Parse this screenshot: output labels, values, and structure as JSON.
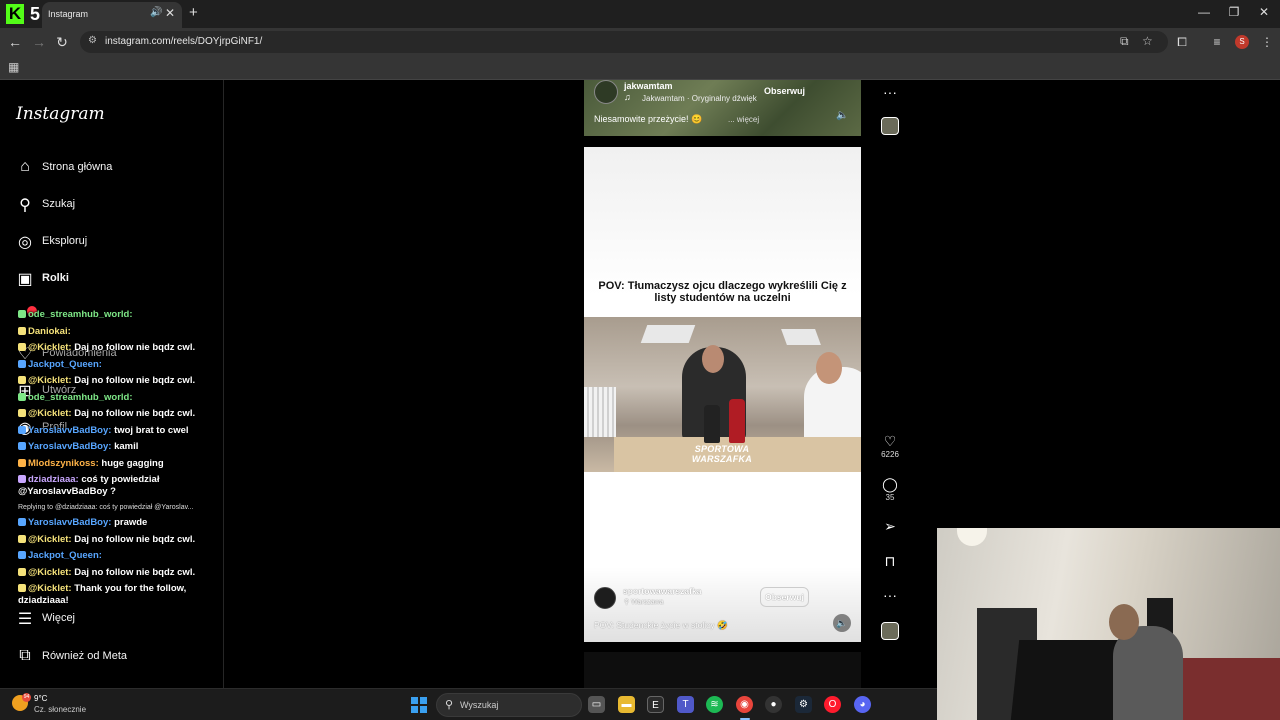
{
  "browser": {
    "tab_title": "Instagram",
    "tab_audio_icon": "speaker-icon",
    "tab_close": "✕",
    "new_tab": "+",
    "url": "instagram.com/reels/DOYjrpGiNF1/",
    "profile_initial": "S",
    "window_controls": [
      "—",
      "❐",
      "✕"
    ]
  },
  "sidebar": {
    "logo": "Instagram",
    "items": [
      {
        "label": "Strona główna",
        "icon": "home-icon"
      },
      {
        "label": "Szukaj",
        "icon": "search-icon"
      },
      {
        "label": "Eksploruj",
        "icon": "compass-icon"
      },
      {
        "label": "Rolki",
        "icon": "reels-icon"
      },
      {
        "label": "Powiadomienia",
        "icon": "heart-icon"
      },
      {
        "label": "Utwórz",
        "icon": "plus-icon"
      },
      {
        "label": "Profil",
        "icon": "avatar-icon"
      },
      {
        "label": "Więcej",
        "icon": "menu-icon"
      },
      {
        "label": "Również od Meta",
        "icon": "meta-icon"
      }
    ]
  },
  "chat": [
    {
      "user": "ode_streamhub_world:",
      "text": "",
      "color": "#7ee787"
    },
    {
      "user": "Daniokai:",
      "text": "",
      "color": "#f5e27a"
    },
    {
      "user": "@Kicklet:",
      "text": "Daj no follow nie bqdz cwl.",
      "color": "#f5e27a"
    },
    {
      "user": "Jackpot_Queen:",
      "text": "",
      "color": "#58a6ff"
    },
    {
      "user": "@Kicklet:",
      "text": "Daj no follow nie bqdz cwl.",
      "color": "#f5e27a"
    },
    {
      "user": "ode_streamhub_world:",
      "text": "",
      "color": "#7ee787"
    },
    {
      "user": "@Kicklet:",
      "text": "Daj no follow nie bqdz cwl.",
      "color": "#f5e27a"
    },
    {
      "user": "YaroslavvBadBoy:",
      "text": "twoj brat to cwel",
      "color": "#58a6ff"
    },
    {
      "user": "YaroslavvBadBoy:",
      "text": "kamil",
      "color": "#58a6ff"
    },
    {
      "user": "Mlodszynikoss:",
      "text": "huge gagging",
      "color": "#ffb347"
    },
    {
      "user": "dziadziaaa:",
      "text": "coś ty powiedział @YaroslavvBadBoy ?",
      "color": "#c9a7ff"
    },
    {
      "reply": "Replying to @dziadziaaa: coś ty powiedział @Yaroslav..."
    },
    {
      "user": "YaroslavvBadBoy:",
      "text": "prawde",
      "color": "#58a6ff"
    },
    {
      "user": "@Kicklet:",
      "text": "Daj no follow nie bqdz cwl.",
      "color": "#f5e27a"
    },
    {
      "user": "Jackpot_Queen:",
      "text": "",
      "color": "#58a6ff"
    },
    {
      "user": "@Kicklet:",
      "text": "Daj no follow nie bqdz cwl.",
      "color": "#f5e27a"
    },
    {
      "user": "@Kicklet:",
      "text": "Thank you for the follow, dziadziaaa!",
      "color": "#f5e27a"
    }
  ],
  "reel_prev": {
    "username": "jakwamtam",
    "audio": "Jakwamtam · Oryginalny dźwięk",
    "follow": "Obserwuj",
    "caption": "Niesamowite przeżycie! 😊",
    "more": "... więcej"
  },
  "reel": {
    "title": "POV: Tłumaczysz ojcu dlaczego wykreślili Cię z listy studentów na uczelni",
    "watermark": "SPORTOWA WARSZAFKA",
    "username": "sportowawarszafka",
    "location": "Warszawa",
    "follow": "Obserwuj",
    "caption": "POV: Studenckie życie w stolicy 🤣",
    "likes": "6226",
    "comments": "35"
  },
  "taskbar": {
    "temp": "9°C",
    "condition": "Cz. słonecznie",
    "weather_badge": "94",
    "search_placeholder": "Wyszukaj"
  },
  "colors": {
    "kick_green": "#53fc18",
    "ig_bg": "#000000",
    "chrome_toolbar": "#353535"
  }
}
